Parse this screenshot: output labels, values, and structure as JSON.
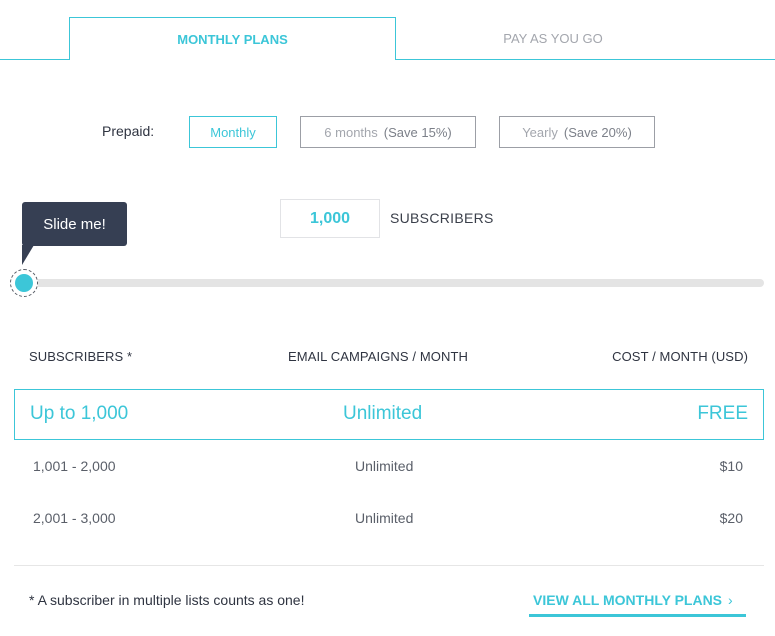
{
  "tabs": [
    {
      "label": "MONTHLY PLANS",
      "active": true
    },
    {
      "label": "PAY AS YOU GO",
      "active": false
    }
  ],
  "prepaid": {
    "label": "Prepaid:",
    "options": [
      {
        "label": "Monthly",
        "save": "",
        "active": true
      },
      {
        "label": "6 months",
        "save": "(Save 15%)",
        "active": false
      },
      {
        "label": "Yearly",
        "save": "(Save 20%)",
        "active": false
      }
    ]
  },
  "slider": {
    "tooltip": "Slide me!",
    "value_display": "1,000",
    "unit_label": "SUBSCRIBERS",
    "position_fraction": 0.0
  },
  "table": {
    "headers": [
      "SUBSCRIBERS *",
      "EMAIL CAMPAIGNS / MONTH",
      "COST / MONTH (USD)"
    ],
    "rows": [
      {
        "subscribers": "Up to 1,000",
        "campaigns": "Unlimited",
        "cost": "FREE",
        "highlighted": true
      },
      {
        "subscribers": "1,001 - 2,000",
        "campaigns": "Unlimited",
        "cost": "$10",
        "highlighted": false
      },
      {
        "subscribers": "2,001 - 3,000",
        "campaigns": "Unlimited",
        "cost": "$20",
        "highlighted": false
      }
    ]
  },
  "footer": {
    "footnote": "* A subscriber in multiple lists counts as one!",
    "view_all_label": "VIEW ALL MONTHLY PLANS",
    "view_all_icon": "chevron-right-icon",
    "view_all_glyph": "›"
  },
  "colors": {
    "accent": "#3cc6d8",
    "tooltip_bg": "#363f53",
    "track": "#e4e4e4",
    "text_dark": "#2f3441",
    "text_muted": "#a3a6ad"
  }
}
